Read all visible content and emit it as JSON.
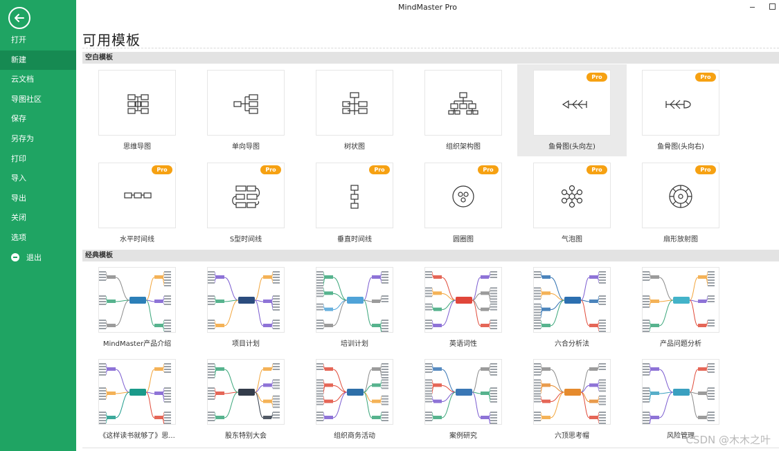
{
  "window": {
    "title": "MindMaster Pro"
  },
  "sidebar": {
    "items": [
      {
        "label": "打开"
      },
      {
        "label": "新建",
        "active": true
      },
      {
        "label": "云文档"
      },
      {
        "label": "导图社区"
      },
      {
        "label": "保存"
      },
      {
        "label": "另存为"
      },
      {
        "label": "打印"
      },
      {
        "label": "导入"
      },
      {
        "label": "导出"
      },
      {
        "label": "关闭"
      },
      {
        "label": "选项"
      },
      {
        "label": "退出"
      }
    ]
  },
  "main": {
    "title": "可用模板",
    "sections": [
      {
        "title": "空白模板"
      },
      {
        "title": "经典模板"
      }
    ],
    "pro_badge": "Pro",
    "blank_templates": [
      {
        "label": "思维导图",
        "icon": "mindmap-icon",
        "pro": false
      },
      {
        "label": "单向导图",
        "icon": "right-map-icon",
        "pro": false
      },
      {
        "label": "树状图",
        "icon": "tree-icon",
        "pro": false
      },
      {
        "label": "组织架构图",
        "icon": "org-chart-icon",
        "pro": false
      },
      {
        "label": "鱼骨图(头向左)",
        "icon": "fishbone-left-icon",
        "pro": true,
        "selected": true
      },
      {
        "label": "鱼骨图(头向右)",
        "icon": "fishbone-right-icon",
        "pro": true
      },
      {
        "label": "水平时间线",
        "icon": "horizontal-timeline-icon",
        "pro": true
      },
      {
        "label": "S型时间线",
        "icon": "s-timeline-icon",
        "pro": true
      },
      {
        "label": "垂直时间线",
        "icon": "vertical-timeline-icon",
        "pro": true
      },
      {
        "label": "圆圈图",
        "icon": "circle-map-icon",
        "pro": true
      },
      {
        "label": "气泡图",
        "icon": "bubble-map-icon",
        "pro": true
      },
      {
        "label": "扇形放射图",
        "icon": "sector-radial-icon",
        "pro": true
      }
    ],
    "classic_templates": [
      {
        "label": "MindMaster产品介绍",
        "accent": "#2c7fb8"
      },
      {
        "label": "项目计划",
        "accent": "#2b4c7e"
      },
      {
        "label": "培训计划",
        "accent": "#4fa3d8"
      },
      {
        "label": "英语词性",
        "accent": "#e0463a"
      },
      {
        "label": "六合分析法",
        "accent": "#2c6fb0"
      },
      {
        "label": "产品问题分析",
        "accent": "#43b3c9"
      },
      {
        "label": "《这样读书就够了》思...",
        "accent": "#1a9a8a"
      },
      {
        "label": "股东特别大会",
        "accent": "#333c4a"
      },
      {
        "label": "组织商务活动",
        "accent": "#2e6fa8"
      },
      {
        "label": "案例研究",
        "accent": "#3a77b5"
      },
      {
        "label": "六顶思考帽",
        "accent": "#e58a2d"
      },
      {
        "label": "风险管理",
        "accent": "#3aa0c0"
      }
    ]
  },
  "watermark": "CSDN @木木之叶",
  "colors": {
    "sidebar": "#1fa463",
    "sidebar_active": "#168a52",
    "pro_badge": "#f6a112"
  }
}
